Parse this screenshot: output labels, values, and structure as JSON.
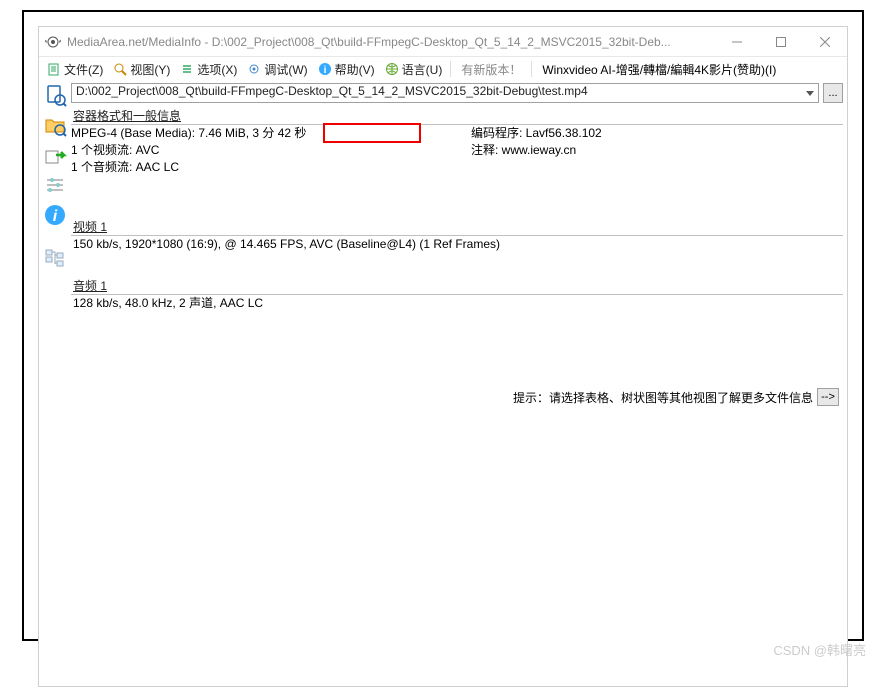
{
  "window": {
    "title": "MediaArea.net/MediaInfo - D:\\002_Project\\008_Qt\\build-FFmpegC-Desktop_Qt_5_14_2_MSVC2015_32bit-Deb..."
  },
  "menu": {
    "file": "文件(Z)",
    "view": "视图(Y)",
    "options": "选项(X)",
    "debug": "调试(W)",
    "help": "帮助(V)",
    "language": "语言(U)",
    "update_notice": "有新版本！",
    "sponsor": "Winxvideo AI-增强/轉檔/編輯4K影片(赞助)(I)"
  },
  "path": {
    "value": "D:\\002_Project\\008_Qt\\build-FFmpegC-Desktop_Qt_5_14_2_MSVC2015_32bit-Debug\\test.mp4",
    "browse": "..."
  },
  "general": {
    "title": "容器格式和一般信息",
    "line1_left": "MPEG-4 (Base Media): 7.46 MiB, 3 分 42 秒",
    "line2_left": "1 个视频流: AVC",
    "line3_left": "1 个音频流: AAC LC",
    "line1_right": "编码程序: Lavf56.38.102",
    "line2_right": "注释: www.ieway.cn"
  },
  "video": {
    "title": "视频 1",
    "line": "150 kb/s, 1920*1080 (16:9), @ 14.465 FPS, AVC (Baseline@L4) (1 Ref Frames)"
  },
  "audio": {
    "title": "音频 1",
    "line": "128 kb/s, 48.0 kHz, 2 声道, AAC LC"
  },
  "hint": {
    "text": "提示：请选择表格、树状图等其他视图了解更多文件信息",
    "btn": "-->"
  },
  "watermark": "CSDN @韩曙亮"
}
